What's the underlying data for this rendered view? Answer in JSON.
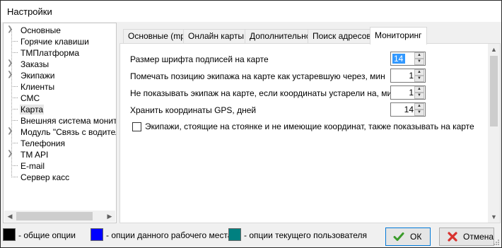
{
  "window": {
    "title": "Настройки"
  },
  "tree": {
    "items": [
      {
        "label": "Основные",
        "expandable": true
      },
      {
        "label": "Горячие клавиши",
        "expandable": false
      },
      {
        "label": "ТМПлатформа",
        "expandable": false
      },
      {
        "label": "Заказы",
        "expandable": true
      },
      {
        "label": "Экипажи",
        "expandable": true
      },
      {
        "label": "Клиенты",
        "expandable": false
      },
      {
        "label": "СМС",
        "expandable": false
      },
      {
        "label": "Карта",
        "expandable": false,
        "selected": true
      },
      {
        "label": "Внешняя система монито",
        "expandable": false
      },
      {
        "label": "Модуль \"Связь с водителя",
        "expandable": true
      },
      {
        "label": "Телефония",
        "expandable": false
      },
      {
        "label": "TM API",
        "expandable": true
      },
      {
        "label": "E-mail",
        "expandable": false
      },
      {
        "label": "Сервер касс",
        "expandable": false
      }
    ]
  },
  "tabs": [
    {
      "label": "Основные (mp)",
      "active": false
    },
    {
      "label": "Онлайн карты",
      "active": false
    },
    {
      "label": "Дополнительно",
      "active": false
    },
    {
      "label": "Поиск адресов",
      "active": false
    },
    {
      "label": "Мониторинг",
      "active": true
    }
  ],
  "settings": {
    "font_size_label": "Размер шрифта подписей на карте",
    "font_size_value": "14",
    "mark_outdated_label": "Помечать позицию экипажа на карте как устаревшую через, мин",
    "mark_outdated_value": "1",
    "hide_crew_label": "Не показывать экипаж на карте, если координаты устарели на, мин",
    "hide_crew_value": "1",
    "keep_gps_label": "Хранить координаты GPS, дней",
    "keep_gps_value": "14",
    "show_parked_label": "Экипажи, стоящие на стоянке и не имеющие координат, также показывать на карте",
    "show_parked_checked": false
  },
  "legend": {
    "common": {
      "label": "- общие опции",
      "color": "#000000"
    },
    "workplace": {
      "label": "- опции данного рабочего места",
      "color": "#0000ff"
    },
    "user": {
      "label": "- опции текущего пользователя",
      "color": "#008080"
    }
  },
  "buttons": {
    "ok_label": "ОК",
    "cancel_label": "Отмена"
  },
  "icons": {
    "ok": "check-icon",
    "cancel": "close-x-icon"
  }
}
